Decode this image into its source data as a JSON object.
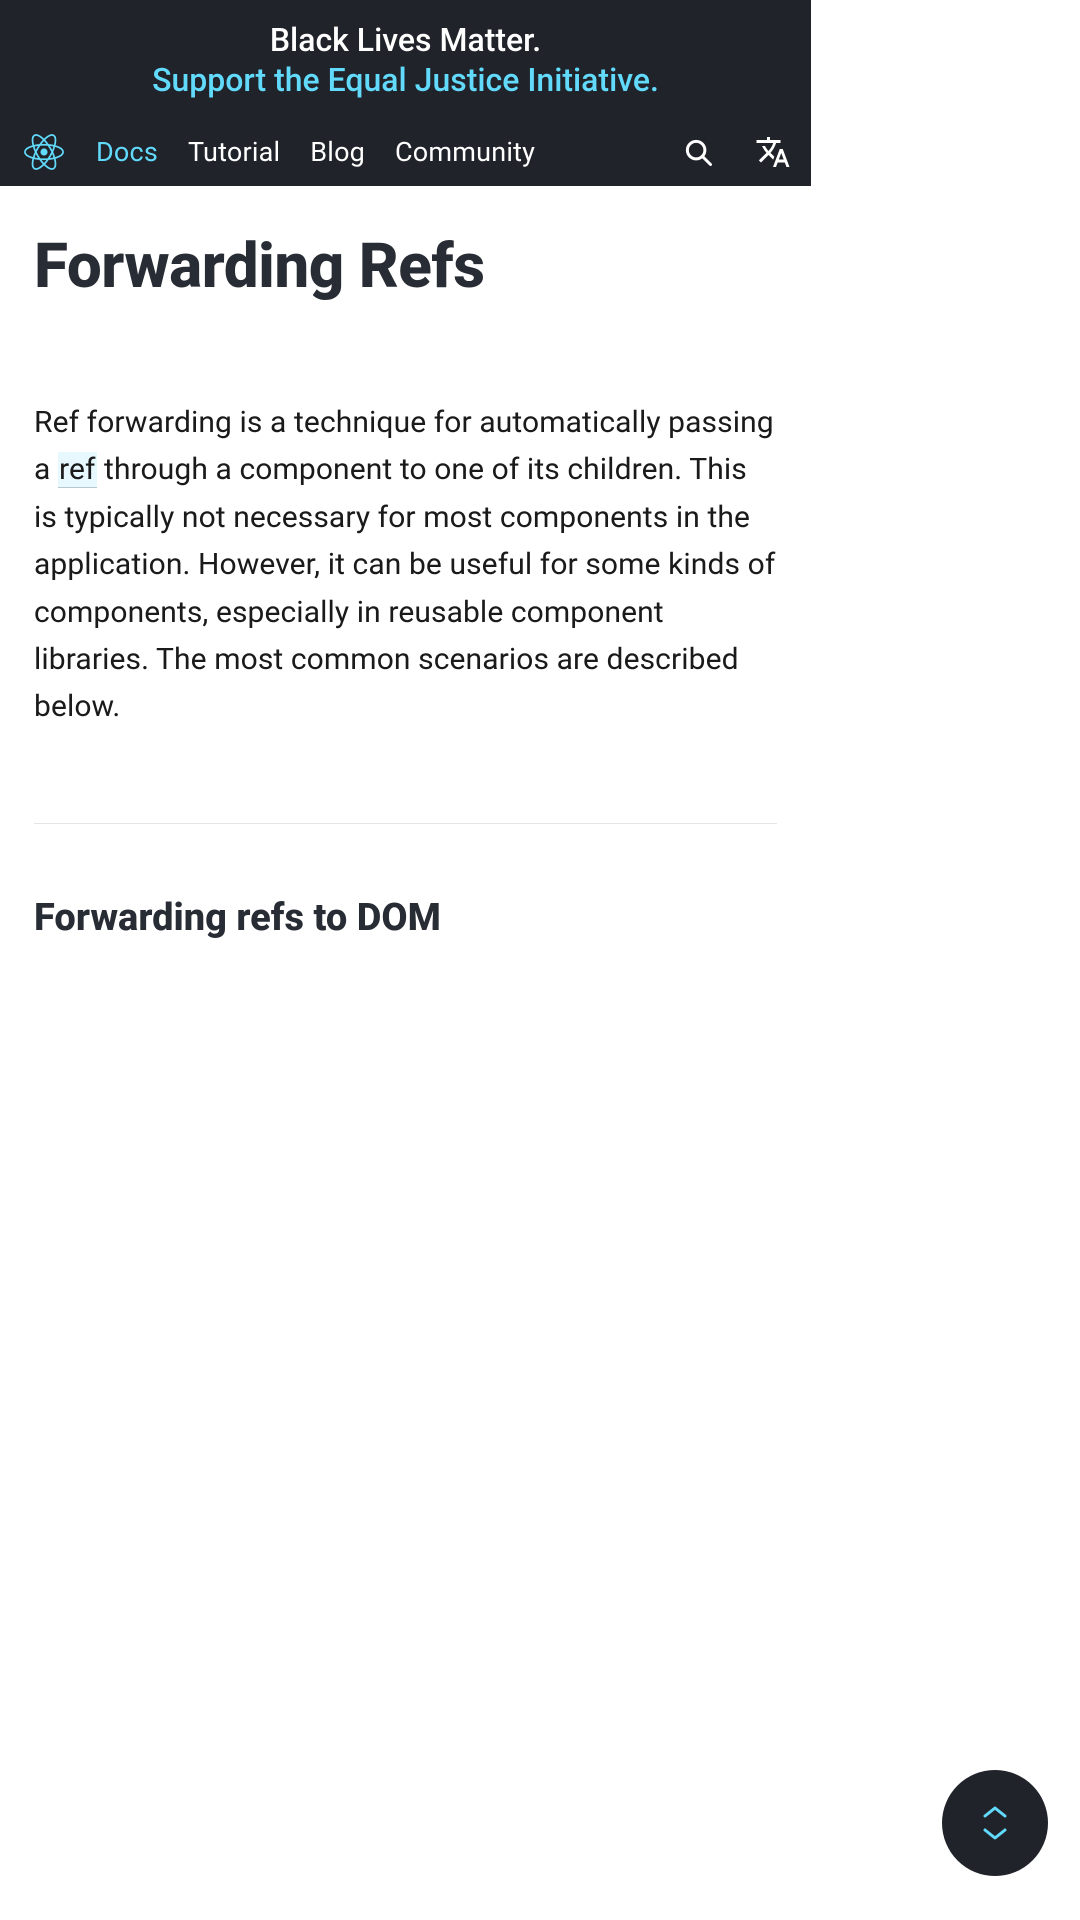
{
  "banner": {
    "line1": "Black Lives Matter.",
    "line2": "Support the Equal Justice Initiative."
  },
  "nav": {
    "items": [
      {
        "label": "Docs",
        "active": true
      },
      {
        "label": "Tutorial",
        "active": false
      },
      {
        "label": "Blog",
        "active": false
      },
      {
        "label": "Community",
        "active": false
      }
    ]
  },
  "article": {
    "title": "Forwarding Refs",
    "intro_pre": "Ref forwarding is a technique for automatically passing a ",
    "intro_link": "ref",
    "intro_post": " through a component to one of its children. This is typically not necessary for most components in the application. However, it can be useful for some kinds of components, especially in reusable component libraries. The most common scenarios are described below.",
    "section1_title": "Forwarding refs to DOM"
  }
}
